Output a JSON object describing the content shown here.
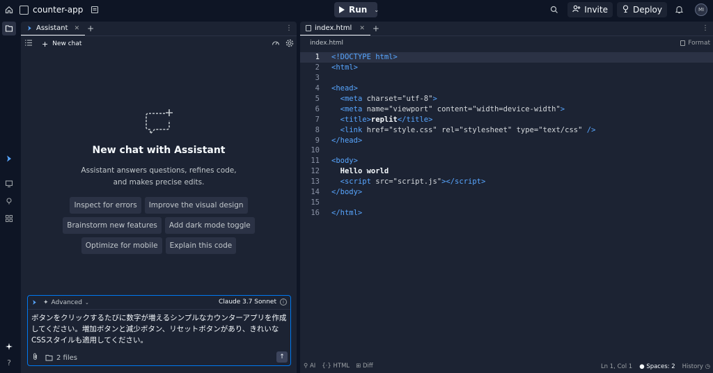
{
  "topbar": {
    "repl_name": "counter-app",
    "run_label": "Run",
    "invite_label": "Invite",
    "deploy_label": "Deploy",
    "avatar_initials": "MI"
  },
  "assistant": {
    "tab_label": "Assistant",
    "new_chat_label": "New chat",
    "empty_title": "New chat with Assistant",
    "empty_description": "Assistant answers questions, refines code, and makes precise edits.",
    "suggestions": [
      "Inspect for errors",
      "Improve the visual design",
      "Brainstorm new features",
      "Add dark mode toggle",
      "Optimize for mobile",
      "Explain this code"
    ],
    "composer": {
      "mode_label": "Advanced",
      "model_label": "Claude 3.7 Sonnet",
      "message": "ボタンをクリックするたびに数字が増えるシンプルなカウンターアプリを作成してください。増加ボタンと減少ボタン、リセットボタンがあり、きれいなCSSスタイルも適用してください。",
      "attachments_label": "2 files"
    }
  },
  "editor": {
    "tab_label": "index.html",
    "breadcrumb": "index.html",
    "format_label": "Format",
    "current_line": 1,
    "status": {
      "ai": "AI",
      "lang": "HTML",
      "diff": "Diff",
      "cursor": "Ln 1, Col 1",
      "spaces": "Spaces: 2",
      "history": "History"
    }
  },
  "colors": {
    "background": "#0e1525",
    "panel": "#1c2333",
    "accent": "#0079f2",
    "tag": "#58a6ff"
  }
}
